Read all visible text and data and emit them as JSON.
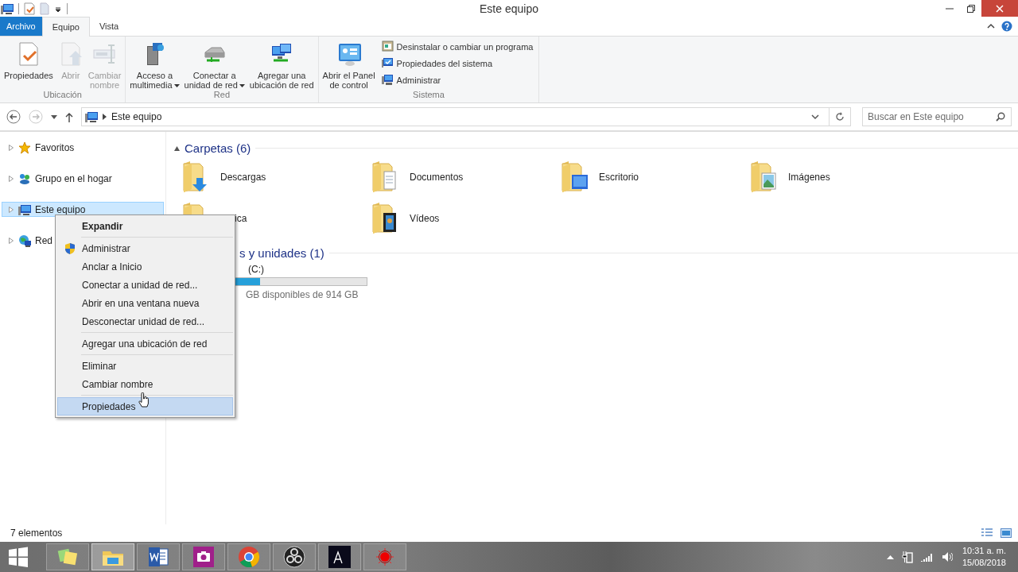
{
  "window": {
    "title": "Este equipo"
  },
  "ribbon": {
    "tabs": [
      {
        "label": "Archivo",
        "kind": "file",
        "selected": false
      },
      {
        "label": "Equipo",
        "kind": "tab",
        "selected": true
      },
      {
        "label": "Vista",
        "kind": "tab",
        "selected": false
      }
    ],
    "groups": [
      {
        "label": "Ubicación",
        "buttons": [
          {
            "label": "Propiedades",
            "kind": "properties",
            "disabled": false,
            "dropdown": false
          },
          {
            "label": "Abrir",
            "kind": "open",
            "disabled": true,
            "dropdown": false
          },
          {
            "label": "Cambiar\nnombre",
            "kind": "rename",
            "disabled": true,
            "dropdown": false
          }
        ]
      },
      {
        "label": "Red",
        "buttons": [
          {
            "label": "Acceso a\nmultimedia",
            "kind": "media",
            "disabled": false,
            "dropdown": true
          },
          {
            "label": "Conectar a\nunidad de red",
            "kind": "drive",
            "disabled": false,
            "dropdown": true
          },
          {
            "label": "Agregar una\nubicación de red",
            "kind": "netloc",
            "disabled": false,
            "dropdown": false
          }
        ]
      },
      {
        "label": "Sistema",
        "buttons": [
          {
            "label": "Abrir el Panel\nde control",
            "kind": "panel",
            "disabled": false,
            "dropdown": false
          }
        ],
        "small_buttons": [
          {
            "label": "Desinstalar o cambiar un programa",
            "kind": "programs"
          },
          {
            "label": "Propiedades del sistema",
            "kind": "sysprops"
          },
          {
            "label": "Administrar",
            "kind": "manage"
          }
        ]
      }
    ]
  },
  "address_bar": {
    "path": "Este equipo",
    "search": {
      "placeholder": "Buscar en Este equipo"
    }
  },
  "sidebar": {
    "items": [
      {
        "label": "Favoritos",
        "kind": "star",
        "expanded": false,
        "selected": false
      },
      {
        "label": "Grupo en el hogar",
        "kind": "homegroup",
        "expanded": false,
        "selected": false
      },
      {
        "label": "Este equipo",
        "kind": "computer",
        "expanded": false,
        "selected": true
      },
      {
        "label": "Red",
        "kind": "network",
        "expanded": false,
        "selected": false
      }
    ]
  },
  "content": {
    "folders_section": {
      "title": "Carpetas (6)",
      "expanded": true,
      "items": [
        {
          "label": "Descargas",
          "kind": "download"
        },
        {
          "label": "Documentos",
          "kind": "documents"
        },
        {
          "label": "Escritorio",
          "kind": "desktop"
        },
        {
          "label": "Imágenes",
          "kind": "pictures"
        },
        {
          "label": "ica",
          "kind": "music"
        },
        {
          "label": "Vídeos",
          "kind": "videos"
        }
      ]
    },
    "drives_section": {
      "title": "s y unidades (1)",
      "drives": [
        {
          "label": "(C:)",
          "level": 0.25,
          "free": "GB disponibles de 914 GB"
        }
      ]
    }
  },
  "context_menu": {
    "items": [
      {
        "kind": "item",
        "label": "Expandir",
        "bold": true,
        "selected": false
      },
      {
        "kind": "separator"
      },
      {
        "kind": "shield",
        "label": "Administrar",
        "bold": false,
        "selected": false
      },
      {
        "kind": "item",
        "label": "Anclar a Inicio",
        "bold": false,
        "selected": false
      },
      {
        "kind": "item",
        "label": "Conectar a unidad de red...",
        "bold": false,
        "selected": false
      },
      {
        "kind": "item",
        "label": "Abrir en una ventana nueva",
        "bold": false,
        "selected": false
      },
      {
        "kind": "item",
        "label": "Desconectar unidad de red...",
        "bold": false,
        "selected": false
      },
      {
        "kind": "separator"
      },
      {
        "kind": "item",
        "label": "Agregar una ubicación de red",
        "bold": false,
        "selected": false
      },
      {
        "kind": "separator"
      },
      {
        "kind": "item",
        "label": "Eliminar",
        "bold": false,
        "selected": false
      },
      {
        "kind": "item",
        "label": "Cambiar nombre",
        "bold": false,
        "selected": false
      },
      {
        "kind": "separator"
      },
      {
        "kind": "item",
        "label": "Propiedades",
        "bold": false,
        "selected": true
      }
    ]
  },
  "status_bar": {
    "text": "7 elementos"
  },
  "taskbar": {
    "apps": [
      {
        "kind": "notes",
        "active": false
      },
      {
        "kind": "explorer",
        "active": true
      },
      {
        "kind": "word",
        "active": false
      },
      {
        "kind": "camera",
        "active": false
      },
      {
        "kind": "chrome",
        "active": false
      },
      {
        "kind": "obs",
        "active": false
      },
      {
        "kind": "appa",
        "active": false
      },
      {
        "kind": "record",
        "active": false
      }
    ],
    "clock": {
      "time": "10:31 a. m.",
      "date": "15/08/2018"
    }
  }
}
